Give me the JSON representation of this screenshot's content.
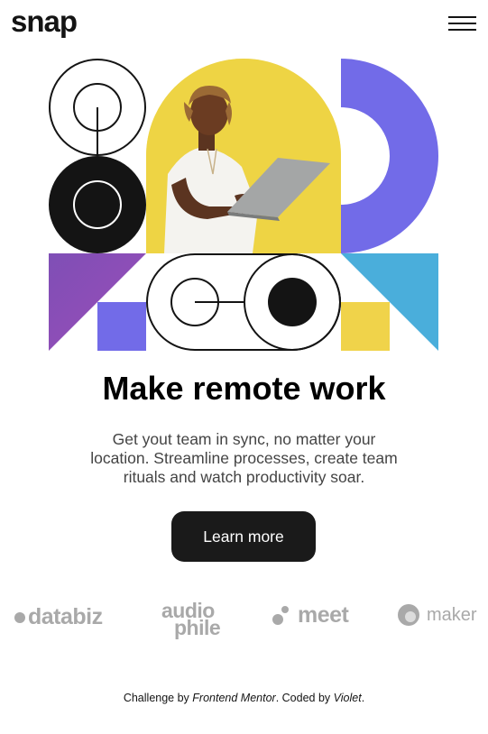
{
  "header": {
    "logo": "snap",
    "menu_icon": "hamburger-menu-icon"
  },
  "hero": {
    "title": "Make remote work",
    "description": "Get yout team in sync, no matter your location. Streamline processes, create team rituals and watch productivity soar.",
    "cta_label": "Learn more"
  },
  "colors": {
    "yellow": "#f0d34a",
    "violet": "#726be8",
    "purple": "#8e4bb8",
    "sky": "#4aaedb",
    "black": "#141414"
  },
  "clients": {
    "databiz": "databiz",
    "audiophile_1": "audio",
    "audiophile_2": "phile",
    "meet": "meet",
    "maker": "maker"
  },
  "attribution": {
    "prefix": "Challenge by ",
    "link1": "Frontend Mentor",
    "middle": ". Coded by ",
    "link2": "Violet",
    "suffix": "."
  }
}
